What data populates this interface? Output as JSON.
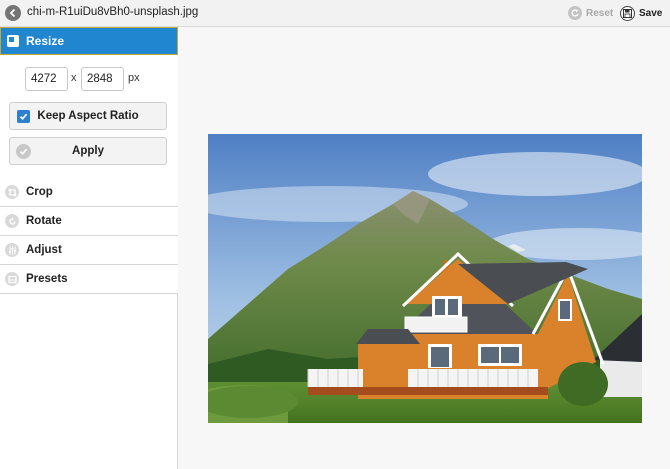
{
  "topbar": {
    "filename": "chi-m-R1uiDu8vBh0-unsplash.jpg",
    "reset_label": "Reset",
    "save_label": "Save"
  },
  "sidebar": {
    "active_section": "Resize",
    "resize": {
      "width": "4272",
      "height": "2848",
      "separator": "x",
      "unit": "px",
      "keep_aspect_label": "Keep Aspect Ratio",
      "keep_aspect_checked": true,
      "apply_label": "Apply"
    },
    "sections": [
      {
        "label": "Crop",
        "icon": "crop-icon"
      },
      {
        "label": "Rotate",
        "icon": "rotate-icon"
      },
      {
        "label": "Adjust",
        "icon": "adjust-icon"
      },
      {
        "label": "Presets",
        "icon": "presets-icon"
      }
    ]
  },
  "colors": {
    "accent": "#1f86cf",
    "house": "#d9822b",
    "roof": "#4a4d52"
  }
}
